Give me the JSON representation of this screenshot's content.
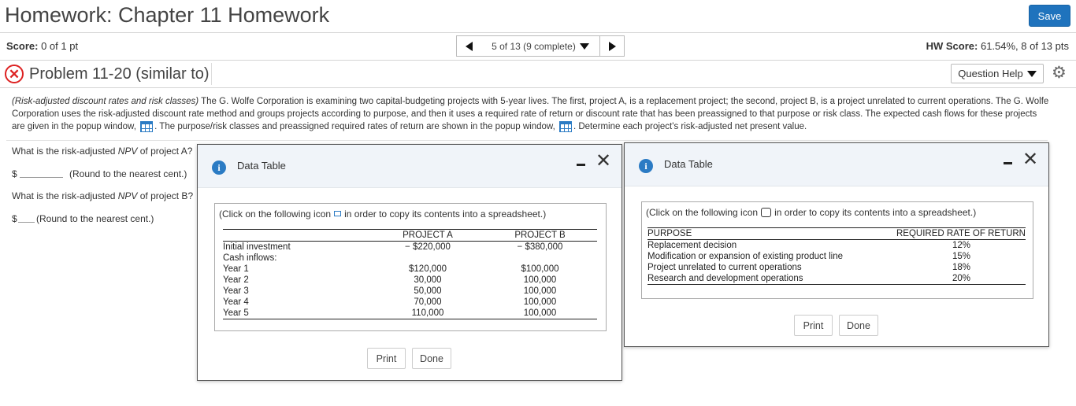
{
  "header": {
    "title": "Homework: Chapter 11 Homework",
    "save_label": "Save"
  },
  "score": {
    "label": "Score:",
    "value": "0 of 1 pt",
    "navigator": "5 of 13 (9 complete)",
    "hw_label": "HW Score:",
    "hw_value": "61.54%, 8 of 13 pts"
  },
  "problem": {
    "title": "Problem 11-20 (similar to)",
    "question_help": "Question Help",
    "description_italic": "(Risk-adjusted discount rates and risk classes)",
    "description_1": " The G. Wolfe Corporation is examining two capital-budgeting projects with 5-year lives. The first, project A, is a replacement project; the second, project B, is a project unrelated to current operations. The G. Wolfe Corporation uses the risk-adjusted discount rate method and groups projects according to purpose, and then it uses a required rate of return or discount rate that has been preassigned to that purpose or risk class. The expected cash flows for these projects are given in the popup window,",
    "description_2": ". The purpose/risk classes and preassigned required rates of return are shown in the popup window,",
    "description_3": ". Determine each project's risk-adjusted net present value."
  },
  "questions": {
    "q1_pre": "What is the risk-adjusted ",
    "q1_npv": "NPV",
    "q1_post": " of project A?",
    "a1_currency": "$",
    "a1_hint": "(Round to the nearest cent.)",
    "q2_pre": "What is the risk-adjusted ",
    "q2_npv": "NPV",
    "q2_post": " of project B?",
    "a2_currency": "$",
    "a2_hint": "(Round to the nearest cent.)"
  },
  "modal1": {
    "title": "Data Table",
    "note_pre": "(Click on the following icon",
    "note_post": "in order to copy its contents into a spreadsheet.)",
    "col_a": "PROJECT A",
    "col_b": "PROJECT B",
    "rows": [
      {
        "label": "Initial investment",
        "a": "− $220,000",
        "b": "− $380,000"
      },
      {
        "label": "Cash inflows:",
        "a": "",
        "b": ""
      },
      {
        "label": "Year 1",
        "a": "$120,000",
        "b": "$100,000"
      },
      {
        "label": "Year 2",
        "a": "30,000",
        "b": "100,000"
      },
      {
        "label": "Year 3",
        "a": "50,000",
        "b": "100,000"
      },
      {
        "label": "Year 4",
        "a": "70,000",
        "b": "100,000"
      },
      {
        "label": "Year 5",
        "a": "110,000",
        "b": "100,000"
      }
    ],
    "print_label": "Print",
    "done_label": "Done"
  },
  "modal2": {
    "title": "Data Table",
    "note_pre": "(Click on the following icon",
    "note_post": "in order to copy its contents into a spreadsheet.)",
    "col_purpose": "PURPOSE",
    "col_rate": "REQUIRED RATE OF RETURN",
    "rows": [
      {
        "purpose": "Replacement decision",
        "rate": "12%"
      },
      {
        "purpose": "Modification or expansion of existing product line",
        "rate": "15%"
      },
      {
        "purpose": "Project unrelated to current operations",
        "rate": "18%"
      },
      {
        "purpose": "Research and development operations",
        "rate": "20%"
      }
    ],
    "print_label": "Print",
    "done_label": "Done"
  },
  "icons": {
    "info": "i",
    "close": "✕",
    "gear": "⚙",
    "x_mark": "✕"
  },
  "colors": {
    "save_button": "#1f73bd",
    "error_red": "#dd2222",
    "info_blue": "#2b7bc4",
    "modal_header": "#f0f4f9"
  }
}
